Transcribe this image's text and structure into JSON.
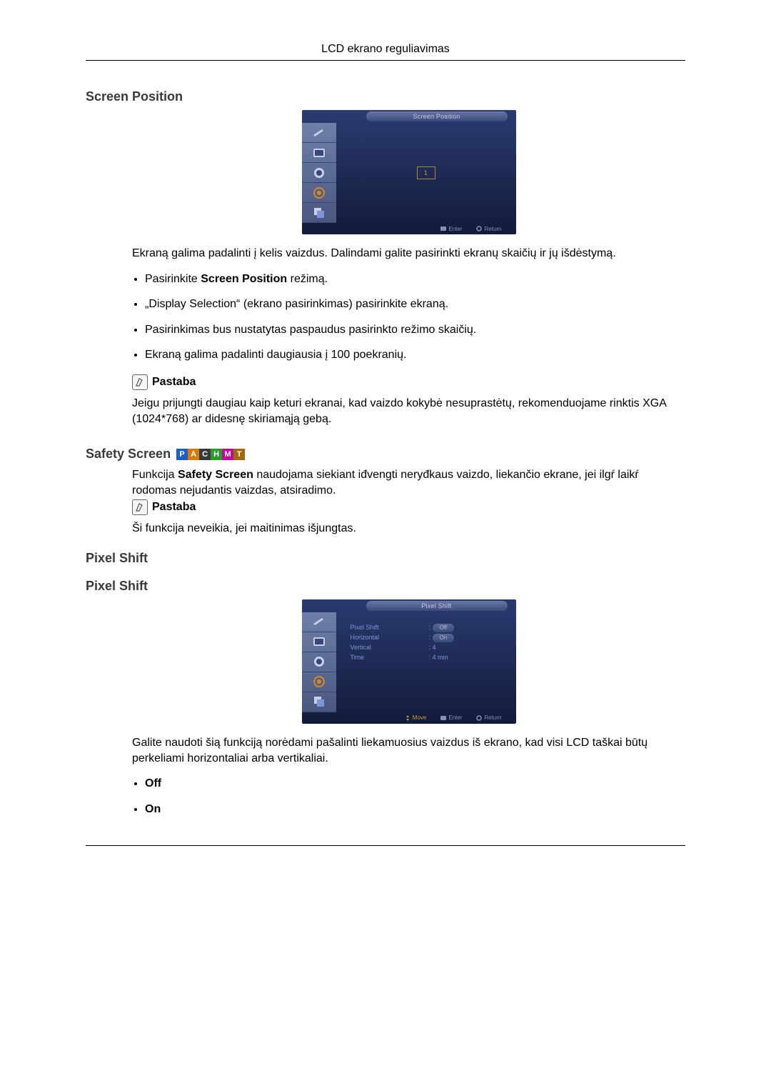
{
  "header": "LCD ekrano reguliavimas",
  "section1": {
    "heading": "Screen Position",
    "osd": {
      "title": "Screen Position",
      "center_value": "1",
      "footer_enter": "Enter",
      "footer_return": "Return"
    },
    "para1": "Ekraną galima padalinti į kelis vaizdus. Dalindami galite pasirinkti ekranų skaičių ir jų išdėstymą.",
    "bullet1_pre": "Pasirinkite ",
    "bullet1_b": "Screen Position",
    "bullet1_post": " režimą.",
    "bullet2": "„Display Selection“ (ekrano pasirinkimas) pasirinkite ekraną.",
    "bullet3": "Pasirinkimas bus nustatytas paspaudus pasirinkto režimo skaičių.",
    "bullet4": "Ekraną galima padalinti daugiausia į 100 poekranių.",
    "note_label": "Pastaba",
    "note_text": "Jeigu prijungti daugiau kaip keturi ekranai, kad vaizdo kokybė nesuprastėtų, rekomenduojame rinktis XGA (1024*768) ar didesnę skiriamąją gebą."
  },
  "section2": {
    "heading": "Safety Screen",
    "chips": [
      "P",
      "A",
      "C",
      "H",
      "M",
      "T"
    ],
    "para_pre": "Funkcija ",
    "para_b": "Safety Screen",
    "para_post": " naudojama siekiant iđvengti neryđkaus vaizdo, liekančio ekrane, jei ilgŕ laikŕ rodomas nejudantis vaizdas, atsiradimo.",
    "note_label": "Pastaba",
    "note_text": "Ši funkcija neveikia, jei maitinimas išjungtas."
  },
  "section3": {
    "heading_a": "Pixel Shift",
    "heading_b": "Pixel Shift",
    "osd": {
      "title": "Pixel Shift",
      "row1_label": "Pixel Shift",
      "row2_label": "Horizontal",
      "row3_label": "Vertical",
      "row4_label": "Time",
      "row1_val": "Off",
      "row2_val": "On",
      "row3_val": ": 4",
      "row4_val": ": 4 min",
      "footer_move": "Move",
      "footer_enter": "Enter",
      "footer_return": "Return"
    },
    "para1": "Galite naudoti šią funkciją norėdami pašalinti liekamuosius vaizdus iš ekrano, kad visi LCD taškai būtų perkeliami horizontaliai arba vertikaliai.",
    "bullet_off": "Off",
    "bullet_on": "On"
  }
}
